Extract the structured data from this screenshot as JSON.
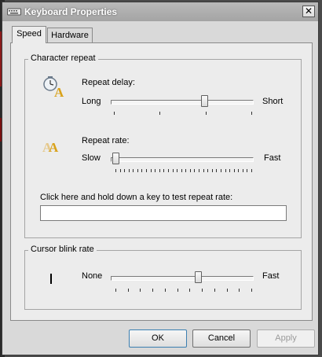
{
  "window": {
    "title": "Keyboard Properties",
    "close_glyph": "✕"
  },
  "tabs": [
    {
      "label": "Speed",
      "active": true
    },
    {
      "label": "Hardware",
      "active": false
    }
  ],
  "character_repeat": {
    "legend": "Character repeat",
    "repeat_delay": {
      "label": "Repeat delay:",
      "min_label": "Long",
      "max_label": "Short",
      "value_fraction": 0.67,
      "tick_count": 4
    },
    "repeat_rate": {
      "label": "Repeat rate:",
      "min_label": "Slow",
      "max_label": "Fast",
      "value_fraction": 0.0,
      "tick_count": 32
    },
    "test_prompt": "Click here and hold down a key to test repeat rate:",
    "test_value": ""
  },
  "cursor_blink": {
    "legend": "Cursor blink rate",
    "min_label": "None",
    "max_label": "Fast",
    "value_fraction": 0.62,
    "tick_count": 12
  },
  "buttons": {
    "ok": "OK",
    "cancel": "Cancel",
    "apply": "Apply"
  },
  "colors": {
    "accent_ok_border": "#3c7fb1",
    "icon_gold": "#d9a21b"
  }
}
